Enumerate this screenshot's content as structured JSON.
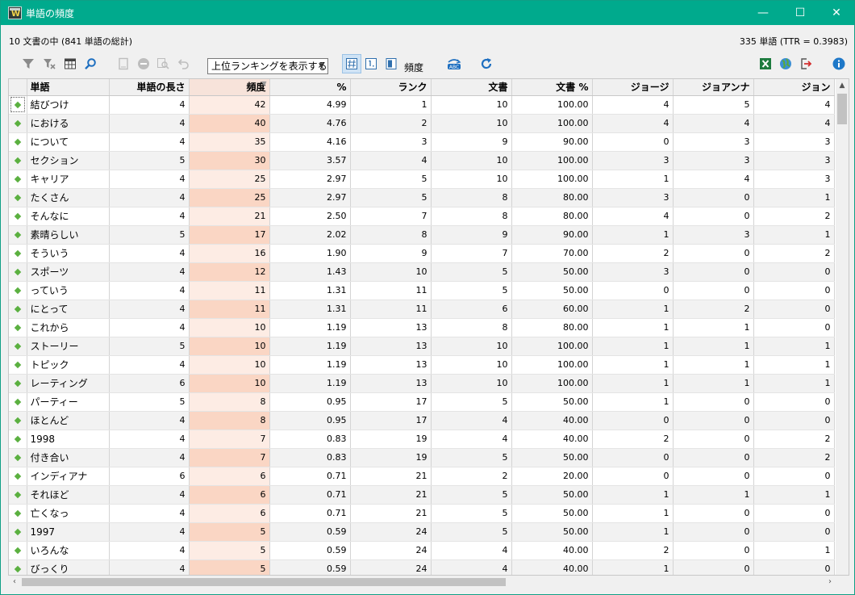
{
  "window": {
    "title": "単語の頻度",
    "minimize_label": "—",
    "maximize_label": "☐",
    "close_label": "✕"
  },
  "summary": {
    "left": "10 文書の中 (841 単語の総計)",
    "right": "335 単語 (TTR = 0.3983)"
  },
  "toolbar": {
    "ranking_select": "上位ランキングを表示する",
    "freq_label": "頻度"
  },
  "colors": {
    "titlebar": "#00aa8d",
    "freq_column": "#fde0d0",
    "marker": "#5bb040"
  },
  "table": {
    "columns": [
      "",
      "単語",
      "単語の長さ",
      "頻度",
      "%",
      "ランク",
      "文書",
      "文書 %",
      "ジョージ",
      "ジョアンナ",
      "ジョン"
    ],
    "rows": [
      [
        "結びつけ",
        "4",
        "42",
        "4.99",
        "1",
        "10",
        "100.00",
        "4",
        "5",
        "4"
      ],
      [
        "における",
        "4",
        "40",
        "4.76",
        "2",
        "10",
        "100.00",
        "4",
        "4",
        "4"
      ],
      [
        "について",
        "4",
        "35",
        "4.16",
        "3",
        "9",
        "90.00",
        "0",
        "3",
        "3"
      ],
      [
        "セクション",
        "5",
        "30",
        "3.57",
        "4",
        "10",
        "100.00",
        "3",
        "3",
        "3"
      ],
      [
        "キャリア",
        "4",
        "25",
        "2.97",
        "5",
        "10",
        "100.00",
        "1",
        "4",
        "3"
      ],
      [
        "たくさん",
        "4",
        "25",
        "2.97",
        "5",
        "8",
        "80.00",
        "3",
        "0",
        "1"
      ],
      [
        "そんなに",
        "4",
        "21",
        "2.50",
        "7",
        "8",
        "80.00",
        "4",
        "0",
        "2"
      ],
      [
        "素晴らしい",
        "5",
        "17",
        "2.02",
        "8",
        "9",
        "90.00",
        "1",
        "3",
        "1"
      ],
      [
        "そういう",
        "4",
        "16",
        "1.90",
        "9",
        "7",
        "70.00",
        "2",
        "0",
        "2"
      ],
      [
        "スポーツ",
        "4",
        "12",
        "1.43",
        "10",
        "5",
        "50.00",
        "3",
        "0",
        "0"
      ],
      [
        "っていう",
        "4",
        "11",
        "1.31",
        "11",
        "5",
        "50.00",
        "0",
        "0",
        "0"
      ],
      [
        "にとって",
        "4",
        "11",
        "1.31",
        "11",
        "6",
        "60.00",
        "1",
        "2",
        "0"
      ],
      [
        "これから",
        "4",
        "10",
        "1.19",
        "13",
        "8",
        "80.00",
        "1",
        "1",
        "0"
      ],
      [
        "ストーリー",
        "5",
        "10",
        "1.19",
        "13",
        "10",
        "100.00",
        "1",
        "1",
        "1"
      ],
      [
        "トピック",
        "4",
        "10",
        "1.19",
        "13",
        "10",
        "100.00",
        "1",
        "1",
        "1"
      ],
      [
        "レーティング",
        "6",
        "10",
        "1.19",
        "13",
        "10",
        "100.00",
        "1",
        "1",
        "1"
      ],
      [
        "パーティー",
        "5",
        "8",
        "0.95",
        "17",
        "5",
        "50.00",
        "1",
        "0",
        "0"
      ],
      [
        "ほとんど",
        "4",
        "8",
        "0.95",
        "17",
        "4",
        "40.00",
        "0",
        "0",
        "0"
      ],
      [
        "1998",
        "4",
        "7",
        "0.83",
        "19",
        "4",
        "40.00",
        "2",
        "0",
        "2"
      ],
      [
        "付き合い",
        "4",
        "7",
        "0.83",
        "19",
        "5",
        "50.00",
        "0",
        "0",
        "2"
      ],
      [
        "インディアナ",
        "6",
        "6",
        "0.71",
        "21",
        "2",
        "20.00",
        "0",
        "0",
        "0"
      ],
      [
        "それほど",
        "4",
        "6",
        "0.71",
        "21",
        "5",
        "50.00",
        "1",
        "1",
        "1"
      ],
      [
        "亡くなっ",
        "4",
        "6",
        "0.71",
        "21",
        "5",
        "50.00",
        "1",
        "0",
        "0"
      ],
      [
        "1997",
        "4",
        "5",
        "0.59",
        "24",
        "5",
        "50.00",
        "1",
        "0",
        "0"
      ],
      [
        "いろんな",
        "4",
        "5",
        "0.59",
        "24",
        "4",
        "40.00",
        "2",
        "0",
        "1"
      ],
      [
        "びっくり",
        "4",
        "5",
        "0.59",
        "24",
        "4",
        "40.00",
        "1",
        "0",
        "0"
      ]
    ]
  }
}
